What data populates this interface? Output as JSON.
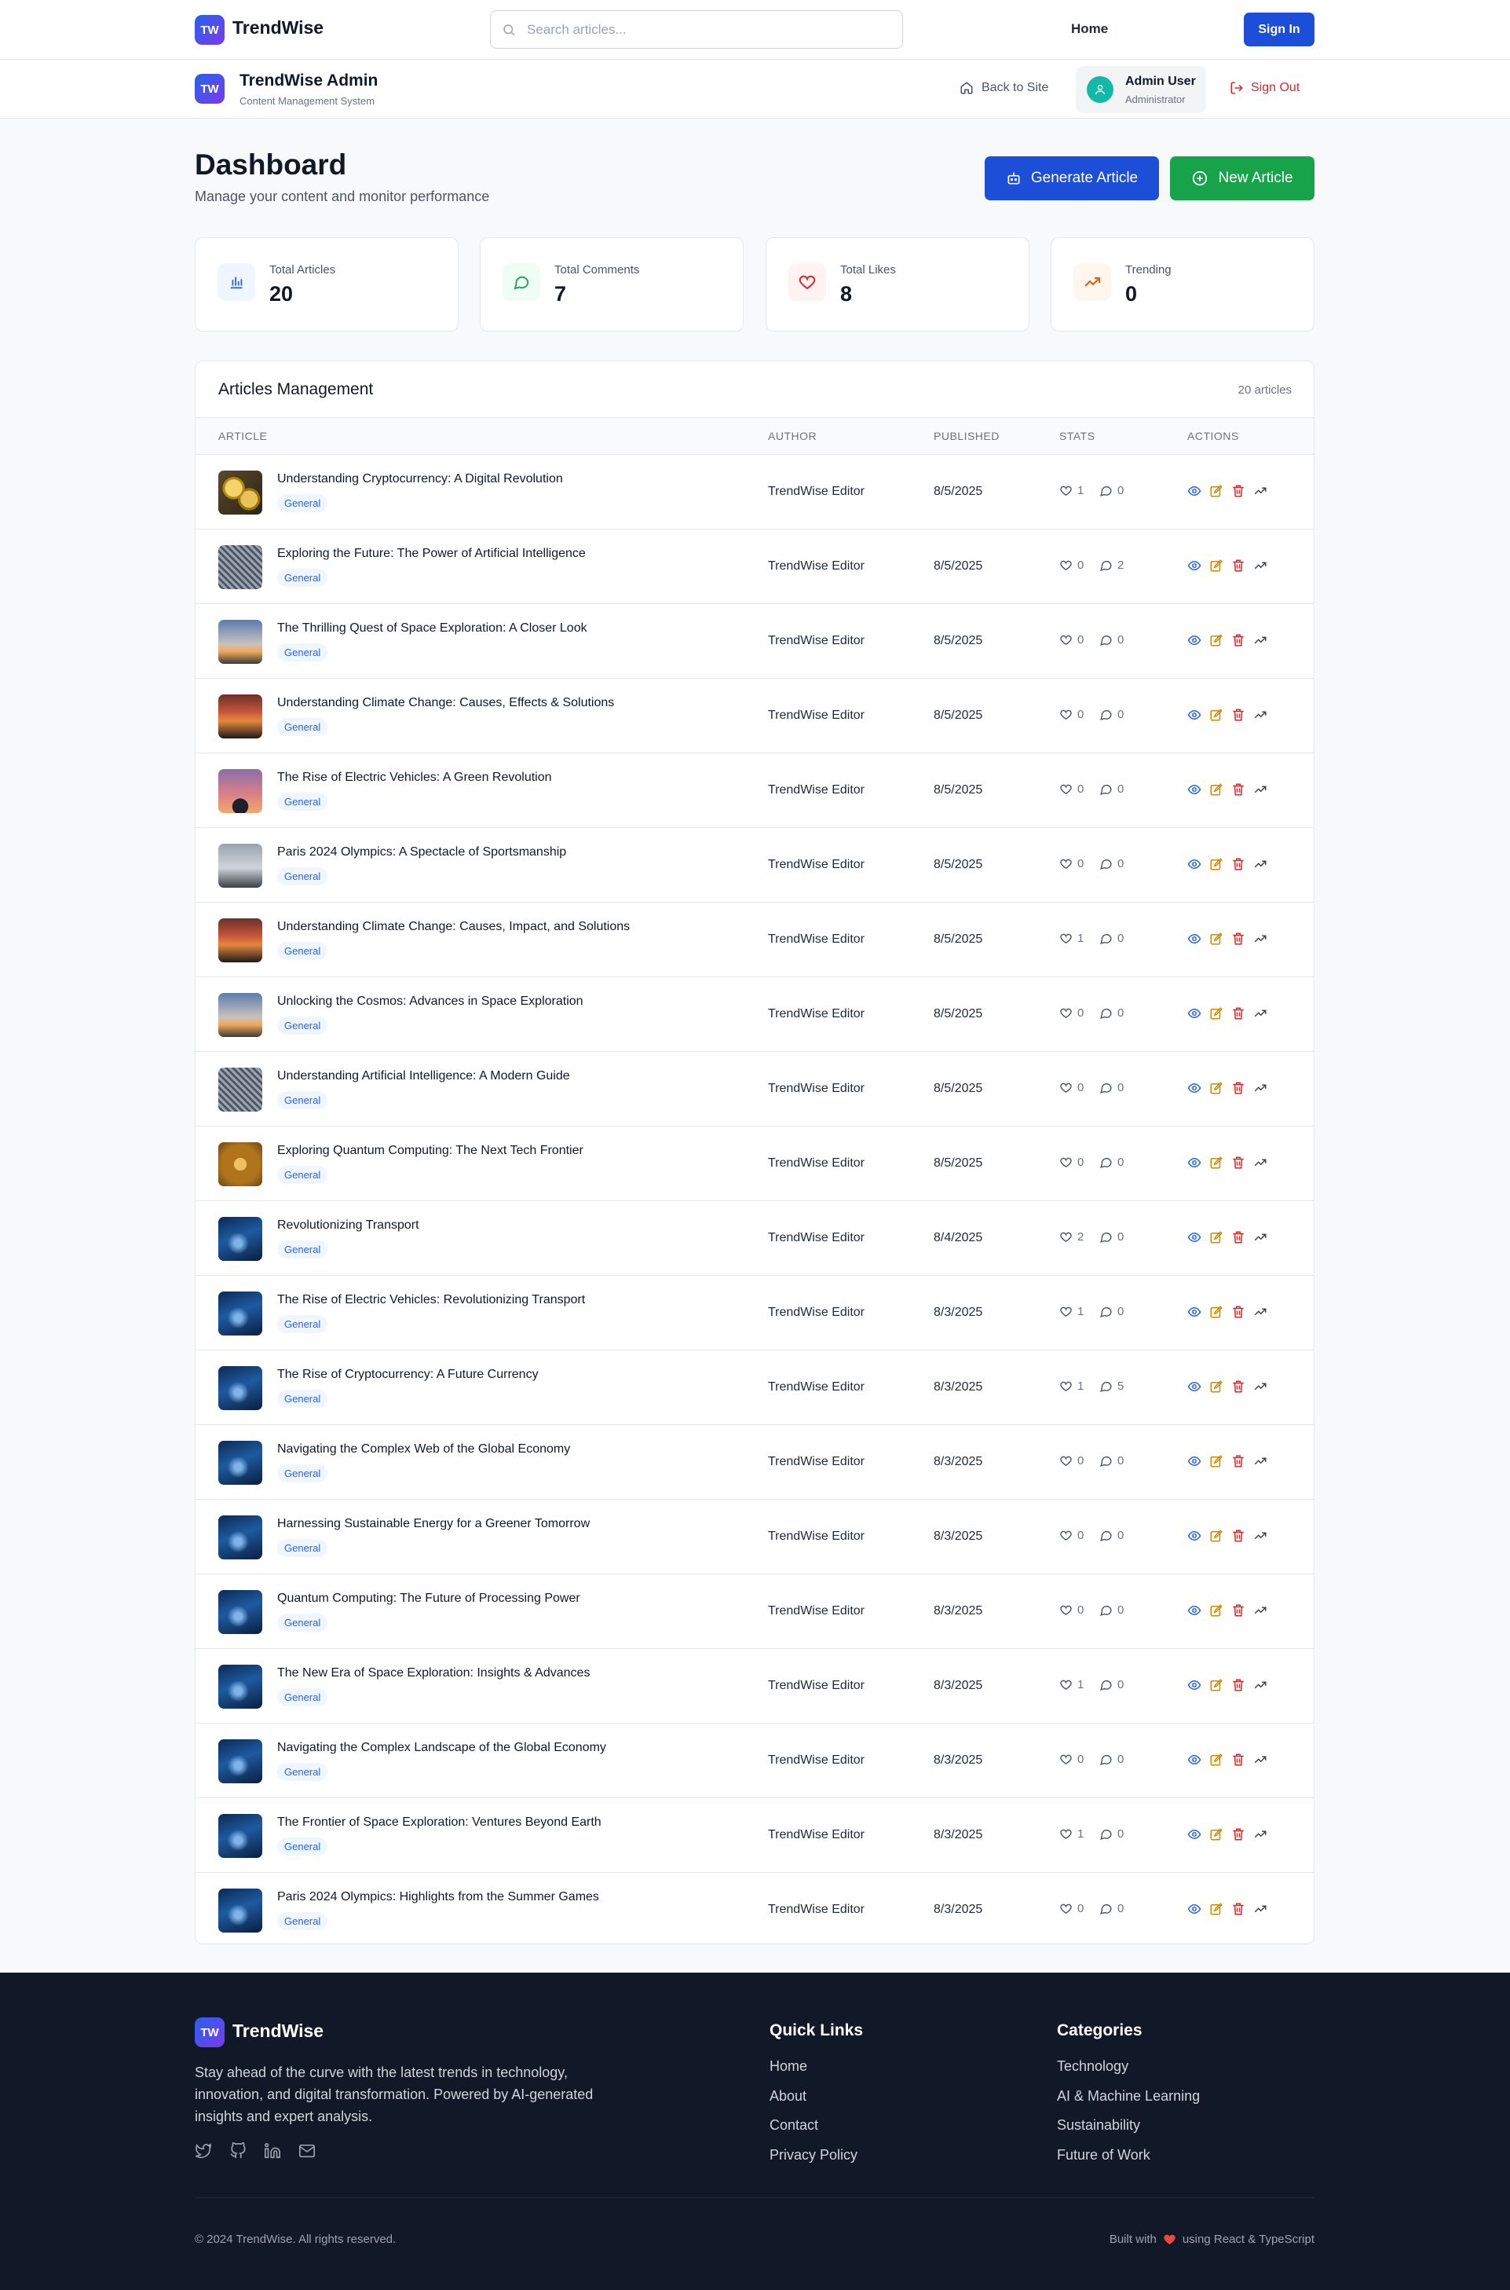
{
  "topnav": {
    "logo_badge": "TW",
    "brand": "TrendWise",
    "search_placeholder": "Search articles...",
    "home_link": "Home",
    "signin_button": "Sign In"
  },
  "admin_header": {
    "logo_badge": "TW",
    "title": "TrendWise Admin",
    "subtitle": "Content Management System",
    "back_to_site": "Back to Site",
    "user_name": "Admin User",
    "user_role": "Administrator",
    "sign_out": "Sign Out"
  },
  "dashboard": {
    "title": "Dashboard",
    "subtitle": "Manage your content and monitor performance",
    "generate_button": "Generate Article",
    "new_button": "New Article"
  },
  "stats": [
    {
      "label": "Total Articles",
      "value": "20",
      "icon": "bar-chart-icon",
      "color": "#2563eb",
      "bg": "#eff6ff"
    },
    {
      "label": "Total Comments",
      "value": "7",
      "icon": "message-icon",
      "color": "#16a34a",
      "bg": "#f0fdf4"
    },
    {
      "label": "Total Likes",
      "value": "8",
      "icon": "heart-icon",
      "color": "#dc2626",
      "bg": "#fef2f2"
    },
    {
      "label": "Trending",
      "value": "0",
      "icon": "trending-up-icon",
      "color": "#ea580c",
      "bg": "#fff7ed"
    }
  ],
  "articles_table": {
    "title": "Articles Management",
    "count_label": "20 articles",
    "columns": [
      "ARTICLE",
      "AUTHOR",
      "PUBLISHED",
      "STATS",
      "ACTIONS"
    ],
    "rows": [
      {
        "title": "Understanding Cryptocurrency: A Digital Revolution",
        "category": "General",
        "author": "TrendWise Editor",
        "published": "8/5/2025",
        "likes": "1",
        "comments": "0",
        "thumb": "crypto"
      },
      {
        "title": "Exploring the Future: The Power of Artificial Intelligence",
        "category": "General",
        "author": "TrendWise Editor",
        "published": "8/5/2025",
        "likes": "0",
        "comments": "2",
        "thumb": "chip"
      },
      {
        "title": "The Thrilling Quest of Space Exploration: A Closer Look",
        "category": "General",
        "author": "TrendWise Editor",
        "published": "8/5/2025",
        "likes": "0",
        "comments": "0",
        "thumb": "rocket"
      },
      {
        "title": "Understanding Climate Change: Causes, Effects & Solutions",
        "category": "General",
        "author": "TrendWise Editor",
        "published": "8/5/2025",
        "likes": "0",
        "comments": "0",
        "thumb": "sunset"
      },
      {
        "title": "The Rise of Electric Vehicles: A Green Revolution",
        "category": "General",
        "author": "TrendWise Editor",
        "published": "8/5/2025",
        "likes": "0",
        "comments": "0",
        "thumb": "dusk"
      },
      {
        "title": "Paris 2024 Olympics: A Spectacle of Sportsmanship",
        "category": "General",
        "author": "TrendWise Editor",
        "published": "8/5/2025",
        "likes": "0",
        "comments": "0",
        "thumb": "paris"
      },
      {
        "title": "Understanding Climate Change: Causes, Impact, and Solutions",
        "category": "General",
        "author": "TrendWise Editor",
        "published": "8/5/2025",
        "likes": "1",
        "comments": "0",
        "thumb": "sunset"
      },
      {
        "title": "Unlocking the Cosmos: Advances in Space Exploration",
        "category": "General",
        "author": "TrendWise Editor",
        "published": "8/5/2025",
        "likes": "0",
        "comments": "0",
        "thumb": "rocket"
      },
      {
        "title": "Understanding Artificial Intelligence: A Modern Guide",
        "category": "General",
        "author": "TrendWise Editor",
        "published": "8/5/2025",
        "likes": "0",
        "comments": "0",
        "thumb": "chip"
      },
      {
        "title": "Exploring Quantum Computing: The Next Tech Frontier",
        "category": "General",
        "author": "TrendWise Editor",
        "published": "8/5/2025",
        "likes": "0",
        "comments": "0",
        "thumb": "gold"
      },
      {
        "title": "Revolutionizing Transport",
        "category": "General",
        "author": "TrendWise Editor",
        "published": "8/4/2025",
        "likes": "2",
        "comments": "0",
        "thumb": "blue"
      },
      {
        "title": "The Rise of Electric Vehicles: Revolutionizing Transport",
        "category": "General",
        "author": "TrendWise Editor",
        "published": "8/3/2025",
        "likes": "1",
        "comments": "0",
        "thumb": "blue"
      },
      {
        "title": "The Rise of Cryptocurrency: A Future Currency",
        "category": "General",
        "author": "TrendWise Editor",
        "published": "8/3/2025",
        "likes": "1",
        "comments": "5",
        "thumb": "blue"
      },
      {
        "title": "Navigating the Complex Web of the Global Economy",
        "category": "General",
        "author": "TrendWise Editor",
        "published": "8/3/2025",
        "likes": "0",
        "comments": "0",
        "thumb": "blue"
      },
      {
        "title": "Harnessing Sustainable Energy for a Greener Tomorrow",
        "category": "General",
        "author": "TrendWise Editor",
        "published": "8/3/2025",
        "likes": "0",
        "comments": "0",
        "thumb": "blue"
      },
      {
        "title": "Quantum Computing: The Future of Processing Power",
        "category": "General",
        "author": "TrendWise Editor",
        "published": "8/3/2025",
        "likes": "0",
        "comments": "0",
        "thumb": "blue"
      },
      {
        "title": "The New Era of Space Exploration: Insights & Advances",
        "category": "General",
        "author": "TrendWise Editor",
        "published": "8/3/2025",
        "likes": "1",
        "comments": "0",
        "thumb": "blue"
      },
      {
        "title": "Navigating the Complex Landscape of the Global Economy",
        "category": "General",
        "author": "TrendWise Editor",
        "published": "8/3/2025",
        "likes": "0",
        "comments": "0",
        "thumb": "blue"
      },
      {
        "title": "The Frontier of Space Exploration: Ventures Beyond Earth",
        "category": "General",
        "author": "TrendWise Editor",
        "published": "8/3/2025",
        "likes": "1",
        "comments": "0",
        "thumb": "blue"
      },
      {
        "title": "Paris 2024 Olympics: Highlights from the Summer Games",
        "category": "General",
        "author": "TrendWise Editor",
        "published": "8/3/2025",
        "likes": "0",
        "comments": "0",
        "thumb": "blue"
      }
    ]
  },
  "footer": {
    "logo_badge": "TW",
    "brand": "TrendWise",
    "description": "Stay ahead of the curve with the latest trends in technology, innovation, and digital transformation. Powered by AI-generated insights and expert analysis.",
    "social_icons": [
      "twitter-icon",
      "github-icon",
      "linkedin-icon",
      "mail-icon"
    ],
    "quick_links_title": "Quick Links",
    "quick_links": [
      "Home",
      "About",
      "Contact",
      "Privacy Policy"
    ],
    "categories_title": "Categories",
    "categories": [
      "Technology",
      "AI & Machine Learning",
      "Sustainability",
      "Future of Work"
    ],
    "copyright": "© 2024 TrendWise. All rights reserved.",
    "built_prefix": "Built with",
    "built_suffix": "using React & TypeScript"
  }
}
